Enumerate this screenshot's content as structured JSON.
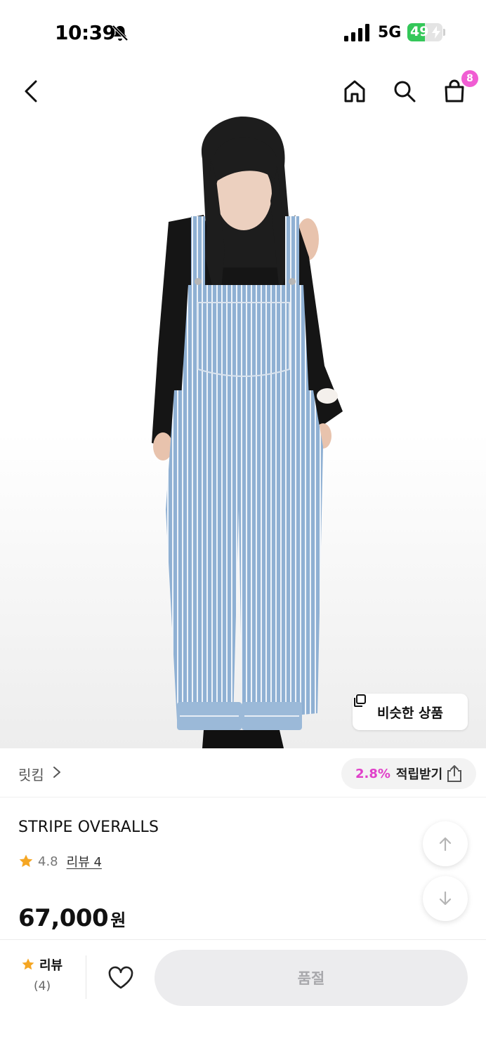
{
  "status_bar": {
    "time": "10:39",
    "network": "5G",
    "battery": "49",
    "battery_level": 0.49
  },
  "nav": {
    "cart_count": "8",
    "icons": [
      "chevron-left-icon",
      "home-icon",
      "search-icon",
      "shopping-bag-icon"
    ]
  },
  "hero": {
    "similar_label": "비슷한 상품"
  },
  "store": {
    "name": "릿킴",
    "points_pct": "2.8%",
    "points_label": "적립받기"
  },
  "product": {
    "title": "STRIPE OVERALLS",
    "rating": "4.8",
    "review_link": "리뷰 4",
    "price": "67,000",
    "currency": "원"
  },
  "bottom_bar": {
    "review_label": "리뷰",
    "review_count": "(4)",
    "soldout_label": "품절"
  },
  "colors": {
    "accent": "#f05dd3",
    "points": "#e040c9",
    "star": "#f5a623",
    "battery": "#34c759"
  }
}
